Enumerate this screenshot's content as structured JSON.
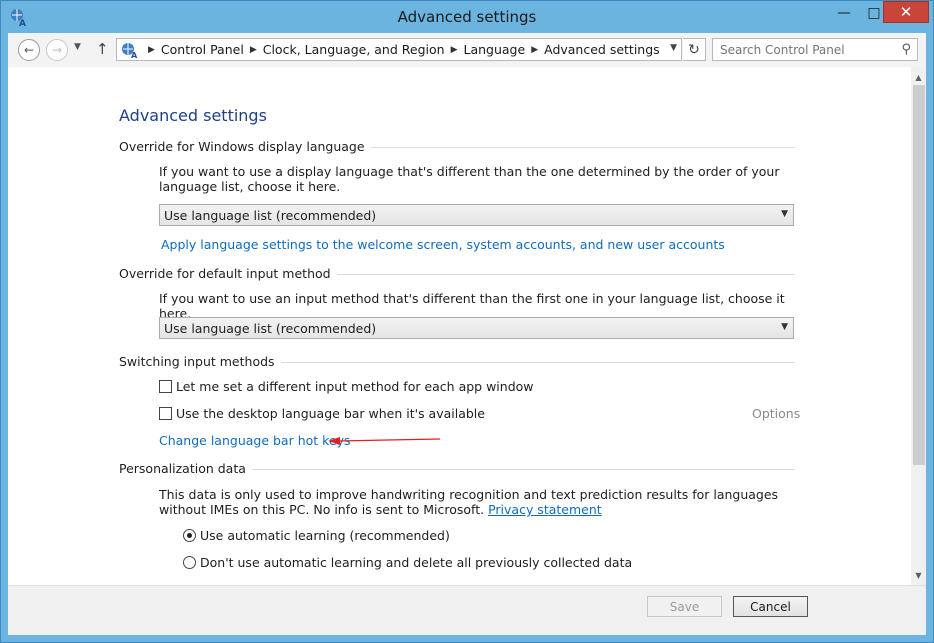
{
  "window": {
    "title": "Advanced settings",
    "controls": {
      "minimize": "—",
      "maximize": "□",
      "close": "✕"
    }
  },
  "address_bar": {
    "breadcrumbs": [
      "Control Panel",
      "Clock, Language, and Region",
      "Language",
      "Advanced settings"
    ],
    "search_placeholder": "Search Control Panel"
  },
  "page": {
    "heading": "Advanced settings",
    "display_language": {
      "label": "Override for Windows display language",
      "description": "If you want to use a display language that's different than the one determined by the order of your language list, choose it here.",
      "selected": "Use language list (recommended)",
      "link": "Apply language settings to the welcome screen, system accounts, and new user accounts"
    },
    "input_method": {
      "label": "Override for default input method",
      "description": "If you want to use an input method that's different than the first one in your language list, choose it here.",
      "selected": "Use language list (recommended)"
    },
    "switching": {
      "label": "Switching input methods",
      "checkbox1": "Let me set a different input method for each app window",
      "checkbox2": "Use the desktop language bar when it's available",
      "options": "Options",
      "hotkeys_link": "Change language bar hot keys"
    },
    "personalization": {
      "label": "Personalization data",
      "description": "This data is only used to improve handwriting recognition and text prediction results for languages without IMEs on this PC. No info is sent to Microsoft.",
      "privacy_link": "Privacy statement",
      "radio1": "Use automatic learning (recommended)",
      "radio2": "Don't use automatic learning and delete all previously collected data"
    }
  },
  "footer": {
    "save": "Save",
    "cancel": "Cancel"
  },
  "colors": {
    "accent_link": "#0f6cbd",
    "heading": "#1e3f8a",
    "close_button": "#c9453a",
    "annotation_arrow": "#e02020"
  }
}
